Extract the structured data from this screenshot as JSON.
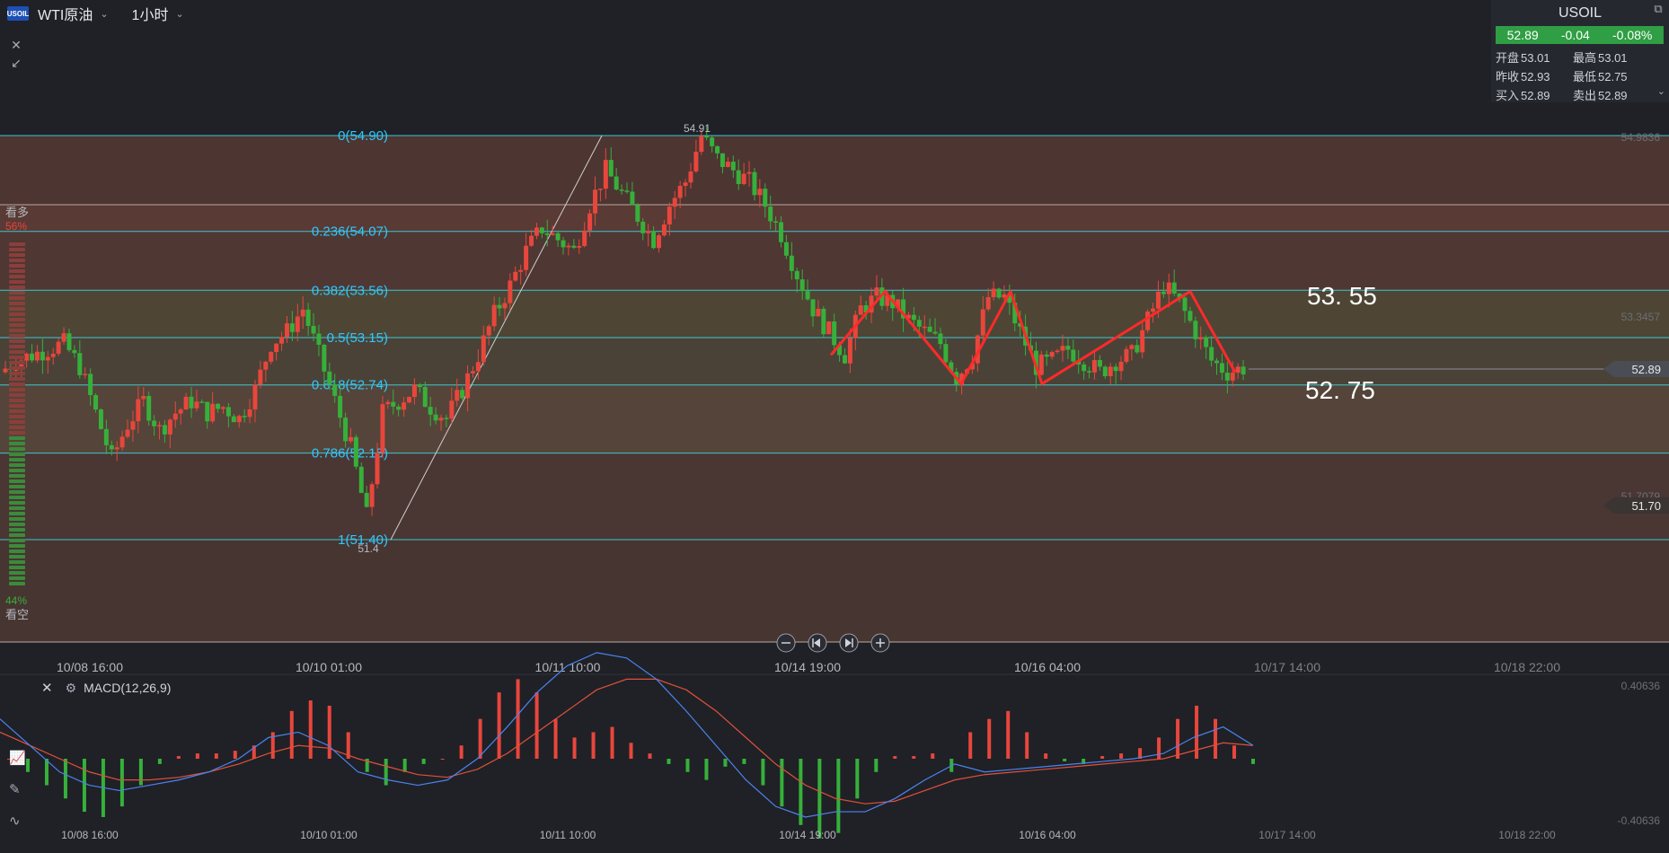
{
  "topbar": {
    "logo_text": "USOIL",
    "symbol": "WTI原油",
    "timeframe": "1小时"
  },
  "quote": {
    "symbol": "USOIL",
    "price": "52.89",
    "change": "-0.04",
    "change_pct": "-0.08%",
    "rows": [
      {
        "l1": "开盘",
        "v1": "53.01",
        "l2": "最高",
        "v2": "53.01"
      },
      {
        "l1": "昨收",
        "v1": "52.93",
        "l2": "最低",
        "v2": "52.75"
      },
      {
        "l1": "买入",
        "v1": "52.89",
        "l2": "卖出",
        "v2": "52.89"
      }
    ]
  },
  "sentiment": {
    "bull_label": "看多",
    "bull_pct": "56%",
    "bear_pct": "44%",
    "bear_label": "看空"
  },
  "price_axis": {
    "top_faded": "54.9836",
    "mid_faded": "53.3457",
    "current": "52.89",
    "lower_faded": "51.7079",
    "lower": "51.70"
  },
  "annotations": {
    "high": "54.91",
    "low": "51.4",
    "big_upper": "53. 55",
    "big_lower": "52. 75"
  },
  "fib": [
    {
      "label": "0(54.90)",
      "price": 54.9
    },
    {
      "label": "0.236(54.07)",
      "price": 54.07
    },
    {
      "label": "0.382(53.56)",
      "price": 53.56
    },
    {
      "label": "0.5(53.15)",
      "price": 53.15
    },
    {
      "label": "0.618(52.74)",
      "price": 52.74
    },
    {
      "label": "0.786(52.15)",
      "price": 52.15
    },
    {
      "label": "1(51.40)",
      "price": 51.4
    }
  ],
  "time_axis": [
    "10/08 16:00",
    "10/10 01:00",
    "10/11 10:00",
    "10/14 19:00",
    "10/16 04:00",
    "10/17 14:00",
    "10/18 22:00"
  ],
  "macd": {
    "title": "MACD(12,26,9)",
    "axis_top": "0.40636",
    "axis_bottom": "-0.40636"
  },
  "colors": {
    "up": "#e8463c",
    "down": "#36b03a",
    "fib_line": "#3fc7cf",
    "fib_label": "#2fc8ff",
    "zigzag": "#ff2a2a",
    "macd_dif": "#4c83f0",
    "macd_dea": "#e0503c",
    "quote_green": "#2f9e44"
  },
  "icons": [
    "close-icon",
    "collapse-icon",
    "zoom-out-icon",
    "scroll-start-icon",
    "scroll-end-icon",
    "zoom-in-icon",
    "settings-icon",
    "external-link-icon",
    "chevron-down-icon",
    "indicator-icon",
    "drawing-icon",
    "wave-icon"
  ],
  "chart_data": {
    "type": "candlestick",
    "instrument": "WTI原油 (USOIL)",
    "timeframe": "1小时",
    "x_ticks": [
      "10/08 16:00",
      "10/10 01:00",
      "10/11 10:00",
      "10/14 19:00",
      "10/16 04:00",
      "10/17 14:00",
      "10/18 22:00"
    ],
    "ylim": [
      50.4,
      55.5
    ],
    "close_path": [
      52.85,
      52.95,
      53.0,
      53.05,
      53.1,
      52.9,
      52.5,
      52.1,
      52.4,
      52.6,
      52.35,
      52.5,
      52.6,
      52.5,
      52.55,
      52.45,
      52.7,
      53.1,
      53.2,
      53.4,
      53.0,
      52.6,
      52.2,
      51.6,
      52.5,
      52.6,
      52.7,
      52.55,
      52.45,
      52.7,
      53.0,
      53.35,
      53.6,
      53.9,
      54.1,
      54.0,
      53.9,
      54.3,
      54.6,
      54.4,
      54.2,
      54.0,
      54.3,
      54.5,
      54.9,
      54.7,
      54.6,
      54.5,
      54.3,
      54.05,
      53.7,
      53.4,
      53.2,
      53.0,
      53.4,
      53.5,
      53.45,
      53.3,
      53.2,
      53.1,
      52.8,
      53.0,
      53.5,
      53.5,
      53.2,
      52.9,
      52.95,
      53.05,
      52.95,
      52.85,
      52.95,
      53.0,
      53.3,
      53.6,
      53.45,
      53.2,
      52.95,
      52.85,
      52.89
    ],
    "fibonacci": [
      {
        "level": 0,
        "price": 54.9
      },
      {
        "level": 0.236,
        "price": 54.07
      },
      {
        "level": 0.382,
        "price": 53.56
      },
      {
        "level": 0.5,
        "price": 53.15
      },
      {
        "level": 0.618,
        "price": 52.74
      },
      {
        "level": 0.786,
        "price": 52.15
      },
      {
        "level": 1,
        "price": 51.4
      }
    ],
    "swing_high": 54.91,
    "swing_low": 51.4,
    "zigzag": [
      53.0,
      53.55,
      52.75,
      53.55,
      52.75,
      53.55,
      52.85
    ],
    "resistance_label": "53. 55",
    "support_label": "52. 75",
    "current_price": 52.89,
    "macd": {
      "name": "MACD(12,26,9)",
      "ylim": [
        -0.40636,
        0.40636
      ],
      "histogram": [
        0.0,
        -0.05,
        -0.1,
        -0.15,
        -0.2,
        -0.22,
        -0.18,
        -0.1,
        -0.02,
        0.01,
        0.02,
        0.02,
        0.03,
        0.05,
        0.1,
        0.18,
        0.22,
        0.2,
        0.1,
        -0.05,
        -0.1,
        -0.05,
        -0.02,
        0.0,
        0.05,
        0.15,
        0.25,
        0.3,
        0.25,
        0.15,
        0.08,
        0.1,
        0.12,
        0.06,
        0.02,
        -0.02,
        -0.05,
        -0.08,
        -0.03,
        -0.02,
        -0.1,
        -0.18,
        -0.25,
        -0.3,
        -0.28,
        -0.15,
        -0.05,
        0.01,
        0.01,
        0.02,
        -0.05,
        0.1,
        0.15,
        0.18,
        0.1,
        0.02,
        -0.01,
        -0.02,
        0.01,
        0.02,
        0.04,
        0.08,
        0.15,
        0.2,
        0.15,
        0.05,
        -0.02
      ],
      "dif": [
        0.15,
        0.05,
        -0.05,
        -0.1,
        -0.12,
        -0.1,
        -0.08,
        -0.05,
        0.0,
        0.08,
        0.1,
        0.05,
        -0.05,
        -0.08,
        -0.1,
        -0.08,
        0.0,
        0.12,
        0.25,
        0.35,
        0.4,
        0.38,
        0.3,
        0.18,
        0.05,
        -0.08,
        -0.18,
        -0.22,
        -0.2,
        -0.2,
        -0.15,
        -0.08,
        -0.02,
        -0.05,
        -0.04,
        -0.03,
        -0.02,
        -0.01,
        0.0,
        0.02,
        0.08,
        0.12,
        0.05
      ],
      "dea": [
        0.1,
        0.05,
        0.0,
        -0.05,
        -0.08,
        -0.08,
        -0.07,
        -0.05,
        -0.02,
        0.02,
        0.05,
        0.04,
        0.0,
        -0.03,
        -0.06,
        -0.07,
        -0.04,
        0.02,
        0.1,
        0.18,
        0.26,
        0.3,
        0.3,
        0.26,
        0.18,
        0.08,
        -0.02,
        -0.1,
        -0.15,
        -0.17,
        -0.16,
        -0.12,
        -0.08,
        -0.06,
        -0.05,
        -0.04,
        -0.03,
        -0.02,
        -0.01,
        0.0,
        0.03,
        0.06,
        0.05
      ]
    }
  }
}
